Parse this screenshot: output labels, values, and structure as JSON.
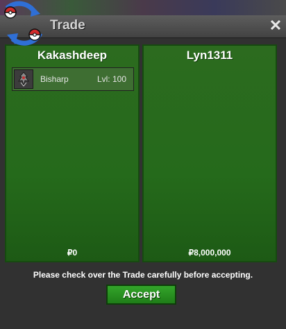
{
  "window": {
    "title": "Trade",
    "close_label": "✕"
  },
  "left_panel": {
    "player_name": "Kakashdeep",
    "items": [
      {
        "name": "Bisharp",
        "level": "Lvl: 100",
        "icon": "bisharp-sprite-icon"
      }
    ],
    "money": "₽0"
  },
  "right_panel": {
    "player_name": "Lyn1311",
    "items": [],
    "money": "₽8,000,000"
  },
  "notice": "Please check over the Trade carefully before accepting.",
  "accept_label": "Accept",
  "colors": {
    "panel_green": "#256a1b",
    "button_green": "#2a9a22",
    "titlebar": "#4d4d4d"
  }
}
